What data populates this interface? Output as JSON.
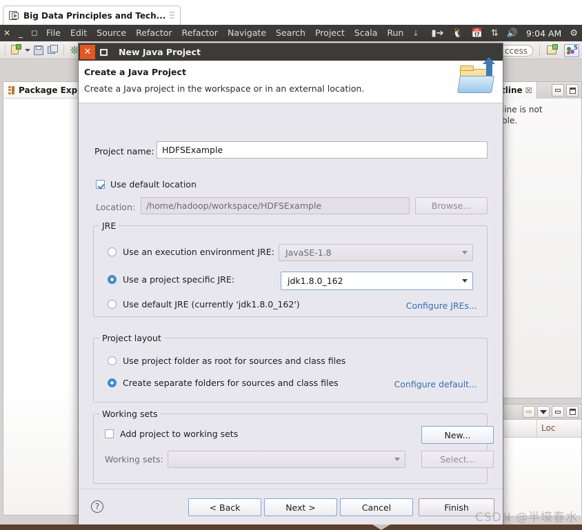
{
  "window_tab": {
    "label": "Big Data Principles and Tech...",
    "icon": "eclipse-launch-icon"
  },
  "menubar": {
    "window_controls": [
      "close",
      "minimize",
      "maximize"
    ],
    "items": [
      "File",
      "Edit",
      "Source",
      "Refactor",
      "Refactor",
      "Navigate",
      "Search",
      "Project",
      "Scala",
      "Run"
    ],
    "overflow": "↓",
    "tray": {
      "icons": [
        "keyboard-layout-icon",
        "linux-penguin-icon",
        "calendar-icon",
        "network-updown-icon",
        "volume-icon"
      ],
      "clock": "9:04 AM",
      "settings_icon": "gear-icon"
    }
  },
  "toolbar": {
    "items": [
      "new-wizard-icon",
      "new-dropdown-arrow",
      "save-icon",
      "save-all-icon",
      "build-icon"
    ],
    "quick_access": "ccess",
    "perspective_icons": [
      "open-perspective-icon",
      "java-perspective-icon"
    ]
  },
  "package_explorer": {
    "title": "Package Explor",
    "icon": "package-explorer-icon"
  },
  "outline_panel": {
    "tab_label": "tline",
    "close_glyph": "☒",
    "message_line1": "line is not",
    "message_line2": "ble.",
    "buttons": [
      "minimize-button",
      "maximize-button"
    ]
  },
  "bottom_right_panel": {
    "toolbar_icons": [
      "sort-icon",
      "view-menu-icon",
      "minimize-button",
      "maximize-button"
    ],
    "column_header": "Loc"
  },
  "dialog": {
    "title": "New Java Project",
    "close_label": "✕",
    "maximize_label": "maximize",
    "header_title": "Create a Java Project",
    "header_subtitle": "Create a Java project in the workspace or in an external location.",
    "wizard_icon": "java-project-folder-icon",
    "project_name_label": "Project name:",
    "project_name_value": "HDFSExample",
    "use_default_location_label": "Use default location",
    "use_default_location_checked": true,
    "location_label": "Location:",
    "location_value": "/home/hadoop/workspace/HDFSExample",
    "browse_label": "Browse...",
    "jre": {
      "group_title": "JRE",
      "option_exec_env_label": "Use an execution environment JRE:",
      "option_exec_env_selected": false,
      "exec_env_value": "JavaSE-1.8",
      "option_project_specific_label": "Use a project specific JRE:",
      "option_project_specific_selected": true,
      "project_specific_value": "jdk1.8.0_162",
      "option_default_label": "Use default JRE (currently 'jdk1.8.0_162')",
      "option_default_selected": false,
      "configure_link": "Configure JREs..."
    },
    "layout": {
      "group_title": "Project layout",
      "option_root_label": "Use project folder as root for sources and class files",
      "option_root_selected": false,
      "option_separate_label": "Create separate folders for sources and class files",
      "option_separate_selected": true,
      "configure_link": "Configure default..."
    },
    "working_sets": {
      "group_title": "Working sets",
      "add_checkbox_label": "Add project to working sets",
      "add_checkbox_checked": false,
      "select_label": "Working sets:",
      "select_value": "",
      "new_button": "New...",
      "select_button": "Select..."
    },
    "footer": {
      "help_label": "?",
      "back": "< Back",
      "next": "Next >",
      "cancel": "Cancel",
      "finish": "Finish"
    }
  },
  "watermark": "CSDN @半壕春水",
  "colors": {
    "dialog_bg": "#e9e7ee",
    "titlebar_bg": "#3c3b37",
    "close_button": "#e8561f",
    "accent_blue": "#2f86d0",
    "link_blue": "#2f6fb5"
  }
}
